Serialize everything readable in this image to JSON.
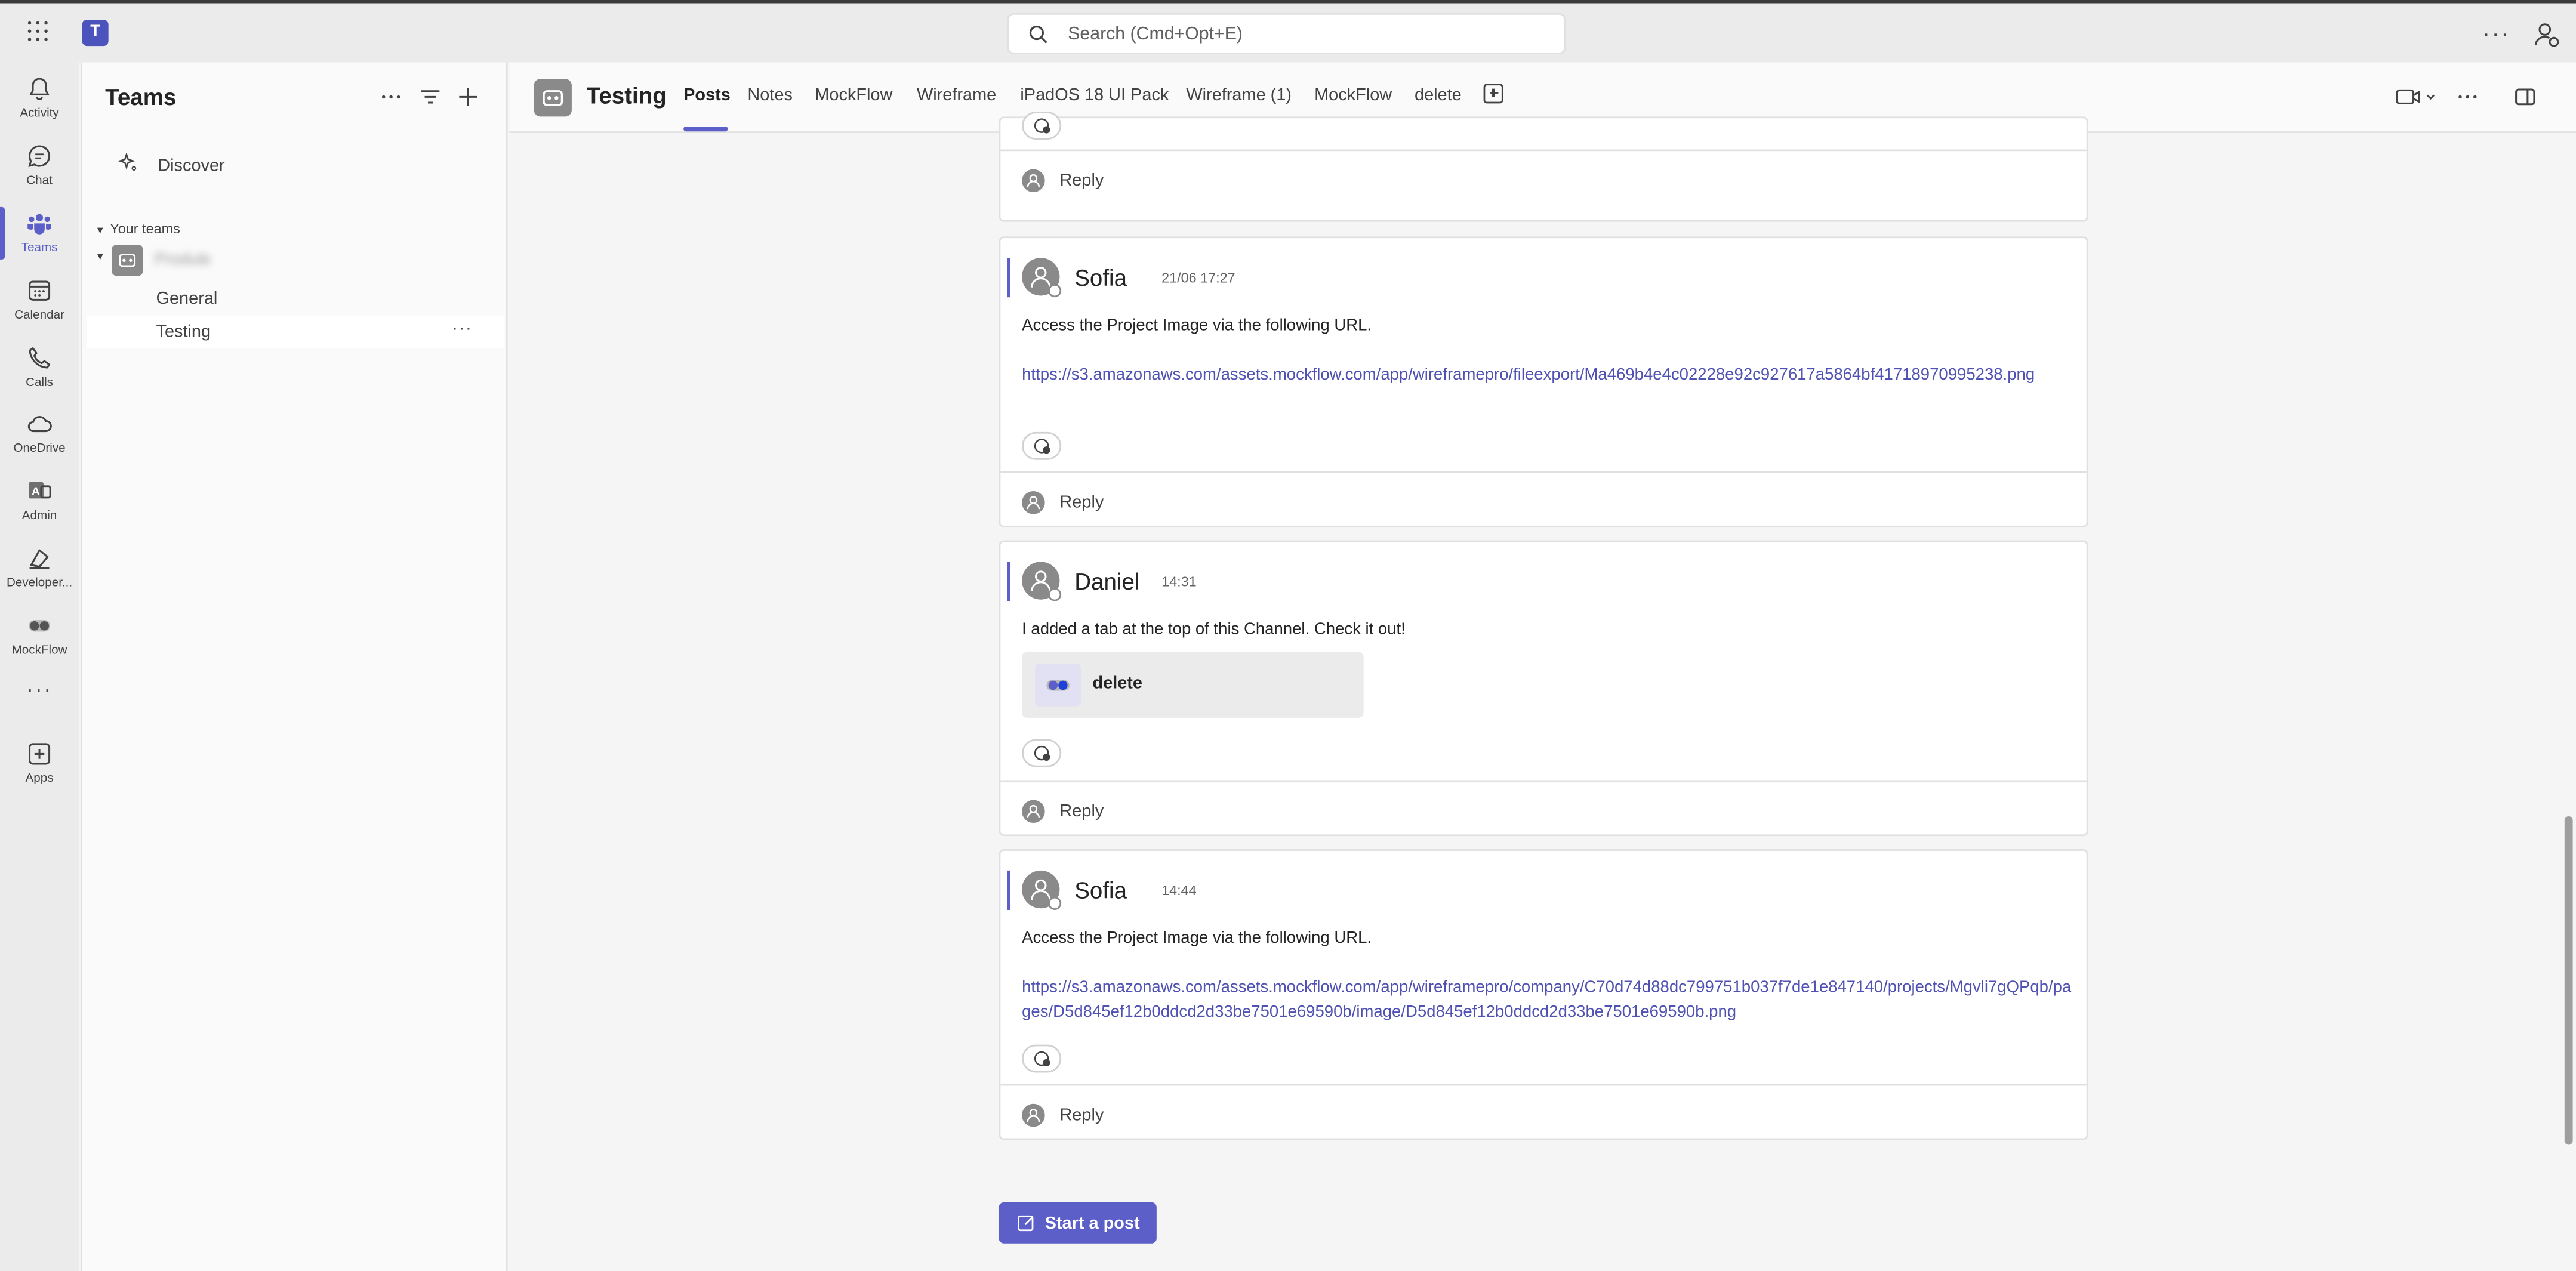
{
  "topbar": {
    "search_placeholder": "Search (Cmd+Opt+E)",
    "more_label": "···"
  },
  "rail": {
    "items": [
      {
        "label": "Activity",
        "icon": "bell-icon"
      },
      {
        "label": "Chat",
        "icon": "chat-icon"
      },
      {
        "label": "Teams",
        "icon": "teams-icon",
        "active": true
      },
      {
        "label": "Calendar",
        "icon": "calendar-icon"
      },
      {
        "label": "Calls",
        "icon": "phone-icon"
      },
      {
        "label": "OneDrive",
        "icon": "cloud-icon"
      },
      {
        "label": "Admin",
        "icon": "admin-icon"
      },
      {
        "label": "Developer...",
        "icon": "developer-icon"
      },
      {
        "label": "MockFlow",
        "icon": "toggle-icon"
      },
      {
        "label": "Apps",
        "icon": "add-app-icon"
      }
    ],
    "more_label": "···"
  },
  "panel": {
    "title": "Teams",
    "discover_label": "Discover",
    "your_teams_label": "Your teams",
    "team_name": "Produle",
    "channels": [
      {
        "label": "General"
      },
      {
        "label": "Testing",
        "selected": true
      }
    ],
    "channel_more": "···"
  },
  "header": {
    "title": "Testing",
    "tabs": [
      "Posts",
      "Notes",
      "MockFlow",
      "Wireframe",
      "iPadOS 18 UI Pack",
      "Wireframe (1)",
      "MockFlow",
      "delete"
    ],
    "active_tab": "Posts"
  },
  "posts": [
    {
      "partial": true,
      "reply_label": "Reply"
    },
    {
      "author": "Sofia",
      "time": "21/06 17:27",
      "body": "Access the Project Image via the following URL.",
      "link": "https://s3.amazonaws.com/assets.mockflow.com/app/wireframepro/fileexport/Ma469b4e4c02228e92c927617a5864bf41718970995238.png",
      "reply_label": "Reply"
    },
    {
      "author": "Daniel",
      "time": "14:31",
      "body": "I added a tab at the top of this Channel. Check it out!",
      "tab_card_label": "delete",
      "reply_label": "Reply"
    },
    {
      "author": "Sofia",
      "time": "14:44",
      "body": "Access the Project Image via the following URL.",
      "link": "https://s3.amazonaws.com/assets.mockflow.com/app/wireframepro/company/C70d74d88dc799751b037f7de1e847140/projects/Mgvli7gQPqb/pages/D5d845ef12b0ddcd2d33be7501e69590b/image/D5d845ef12b0ddcd2d33be7501e69590b.png",
      "reply_label": "Reply"
    }
  ],
  "start_post_label": "Start a post",
  "colors": {
    "accent": "#5b5fc7",
    "link": "#4f52b2",
    "rail_bg": "#ebebeb"
  }
}
